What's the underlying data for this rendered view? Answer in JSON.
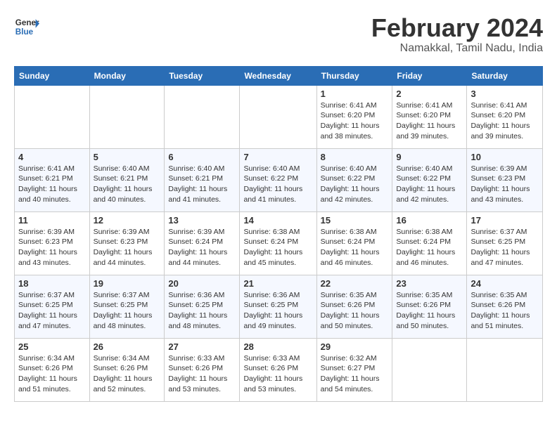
{
  "header": {
    "logo_line1": "General",
    "logo_line2": "Blue",
    "month": "February 2024",
    "location": "Namakkal, Tamil Nadu, India"
  },
  "days_of_week": [
    "Sunday",
    "Monday",
    "Tuesday",
    "Wednesday",
    "Thursday",
    "Friday",
    "Saturday"
  ],
  "weeks": [
    [
      {
        "day": "",
        "info": ""
      },
      {
        "day": "",
        "info": ""
      },
      {
        "day": "",
        "info": ""
      },
      {
        "day": "",
        "info": ""
      },
      {
        "day": "1",
        "info": "Sunrise: 6:41 AM\nSunset: 6:20 PM\nDaylight: 11 hours\nand 38 minutes."
      },
      {
        "day": "2",
        "info": "Sunrise: 6:41 AM\nSunset: 6:20 PM\nDaylight: 11 hours\nand 39 minutes."
      },
      {
        "day": "3",
        "info": "Sunrise: 6:41 AM\nSunset: 6:20 PM\nDaylight: 11 hours\nand 39 minutes."
      }
    ],
    [
      {
        "day": "4",
        "info": "Sunrise: 6:41 AM\nSunset: 6:21 PM\nDaylight: 11 hours\nand 40 minutes."
      },
      {
        "day": "5",
        "info": "Sunrise: 6:40 AM\nSunset: 6:21 PM\nDaylight: 11 hours\nand 40 minutes."
      },
      {
        "day": "6",
        "info": "Sunrise: 6:40 AM\nSunset: 6:21 PM\nDaylight: 11 hours\nand 41 minutes."
      },
      {
        "day": "7",
        "info": "Sunrise: 6:40 AM\nSunset: 6:22 PM\nDaylight: 11 hours\nand 41 minutes."
      },
      {
        "day": "8",
        "info": "Sunrise: 6:40 AM\nSunset: 6:22 PM\nDaylight: 11 hours\nand 42 minutes."
      },
      {
        "day": "9",
        "info": "Sunrise: 6:40 AM\nSunset: 6:22 PM\nDaylight: 11 hours\nand 42 minutes."
      },
      {
        "day": "10",
        "info": "Sunrise: 6:39 AM\nSunset: 6:23 PM\nDaylight: 11 hours\nand 43 minutes."
      }
    ],
    [
      {
        "day": "11",
        "info": "Sunrise: 6:39 AM\nSunset: 6:23 PM\nDaylight: 11 hours\nand 43 minutes."
      },
      {
        "day": "12",
        "info": "Sunrise: 6:39 AM\nSunset: 6:23 PM\nDaylight: 11 hours\nand 44 minutes."
      },
      {
        "day": "13",
        "info": "Sunrise: 6:39 AM\nSunset: 6:24 PM\nDaylight: 11 hours\nand 44 minutes."
      },
      {
        "day": "14",
        "info": "Sunrise: 6:38 AM\nSunset: 6:24 PM\nDaylight: 11 hours\nand 45 minutes."
      },
      {
        "day": "15",
        "info": "Sunrise: 6:38 AM\nSunset: 6:24 PM\nDaylight: 11 hours\nand 46 minutes."
      },
      {
        "day": "16",
        "info": "Sunrise: 6:38 AM\nSunset: 6:24 PM\nDaylight: 11 hours\nand 46 minutes."
      },
      {
        "day": "17",
        "info": "Sunrise: 6:37 AM\nSunset: 6:25 PM\nDaylight: 11 hours\nand 47 minutes."
      }
    ],
    [
      {
        "day": "18",
        "info": "Sunrise: 6:37 AM\nSunset: 6:25 PM\nDaylight: 11 hours\nand 47 minutes."
      },
      {
        "day": "19",
        "info": "Sunrise: 6:37 AM\nSunset: 6:25 PM\nDaylight: 11 hours\nand 48 minutes."
      },
      {
        "day": "20",
        "info": "Sunrise: 6:36 AM\nSunset: 6:25 PM\nDaylight: 11 hours\nand 48 minutes."
      },
      {
        "day": "21",
        "info": "Sunrise: 6:36 AM\nSunset: 6:25 PM\nDaylight: 11 hours\nand 49 minutes."
      },
      {
        "day": "22",
        "info": "Sunrise: 6:35 AM\nSunset: 6:26 PM\nDaylight: 11 hours\nand 50 minutes."
      },
      {
        "day": "23",
        "info": "Sunrise: 6:35 AM\nSunset: 6:26 PM\nDaylight: 11 hours\nand 50 minutes."
      },
      {
        "day": "24",
        "info": "Sunrise: 6:35 AM\nSunset: 6:26 PM\nDaylight: 11 hours\nand 51 minutes."
      }
    ],
    [
      {
        "day": "25",
        "info": "Sunrise: 6:34 AM\nSunset: 6:26 PM\nDaylight: 11 hours\nand 51 minutes."
      },
      {
        "day": "26",
        "info": "Sunrise: 6:34 AM\nSunset: 6:26 PM\nDaylight: 11 hours\nand 52 minutes."
      },
      {
        "day": "27",
        "info": "Sunrise: 6:33 AM\nSunset: 6:26 PM\nDaylight: 11 hours\nand 53 minutes."
      },
      {
        "day": "28",
        "info": "Sunrise: 6:33 AM\nSunset: 6:26 PM\nDaylight: 11 hours\nand 53 minutes."
      },
      {
        "day": "29",
        "info": "Sunrise: 6:32 AM\nSunset: 6:27 PM\nDaylight: 11 hours\nand 54 minutes."
      },
      {
        "day": "",
        "info": ""
      },
      {
        "day": "",
        "info": ""
      }
    ]
  ]
}
